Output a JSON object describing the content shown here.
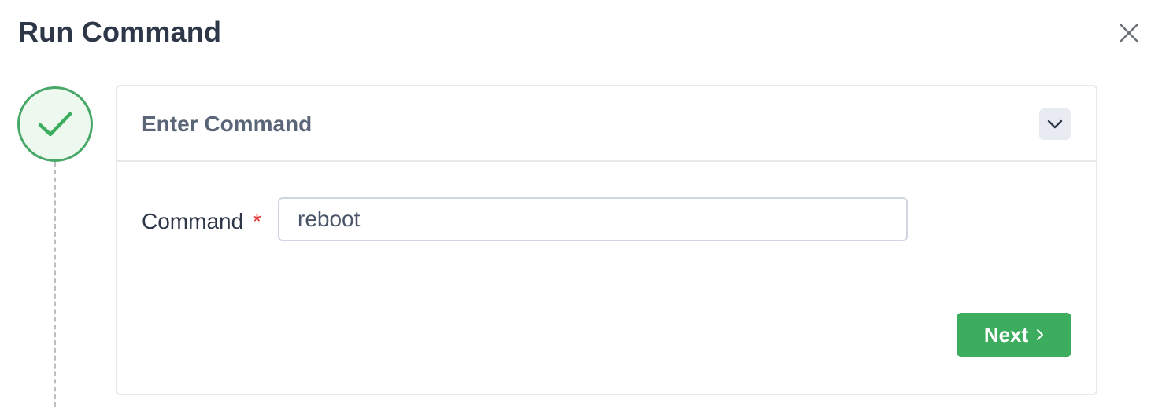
{
  "dialog": {
    "title": "Run Command"
  },
  "icons": {
    "close": "close-icon",
    "step_status": "checkmark-icon",
    "collapse": "chevron-down-icon",
    "next": "chevron-right-icon"
  },
  "step": {
    "status": "completed",
    "card_title": "Enter Command"
  },
  "form": {
    "command_label": "Command",
    "required_marker": "*",
    "command_value": "reboot"
  },
  "actions": {
    "next_label": "Next"
  },
  "colors": {
    "success_green": "#3cad5e",
    "required_red": "#e53e3e",
    "title_text": "#2d3748"
  }
}
